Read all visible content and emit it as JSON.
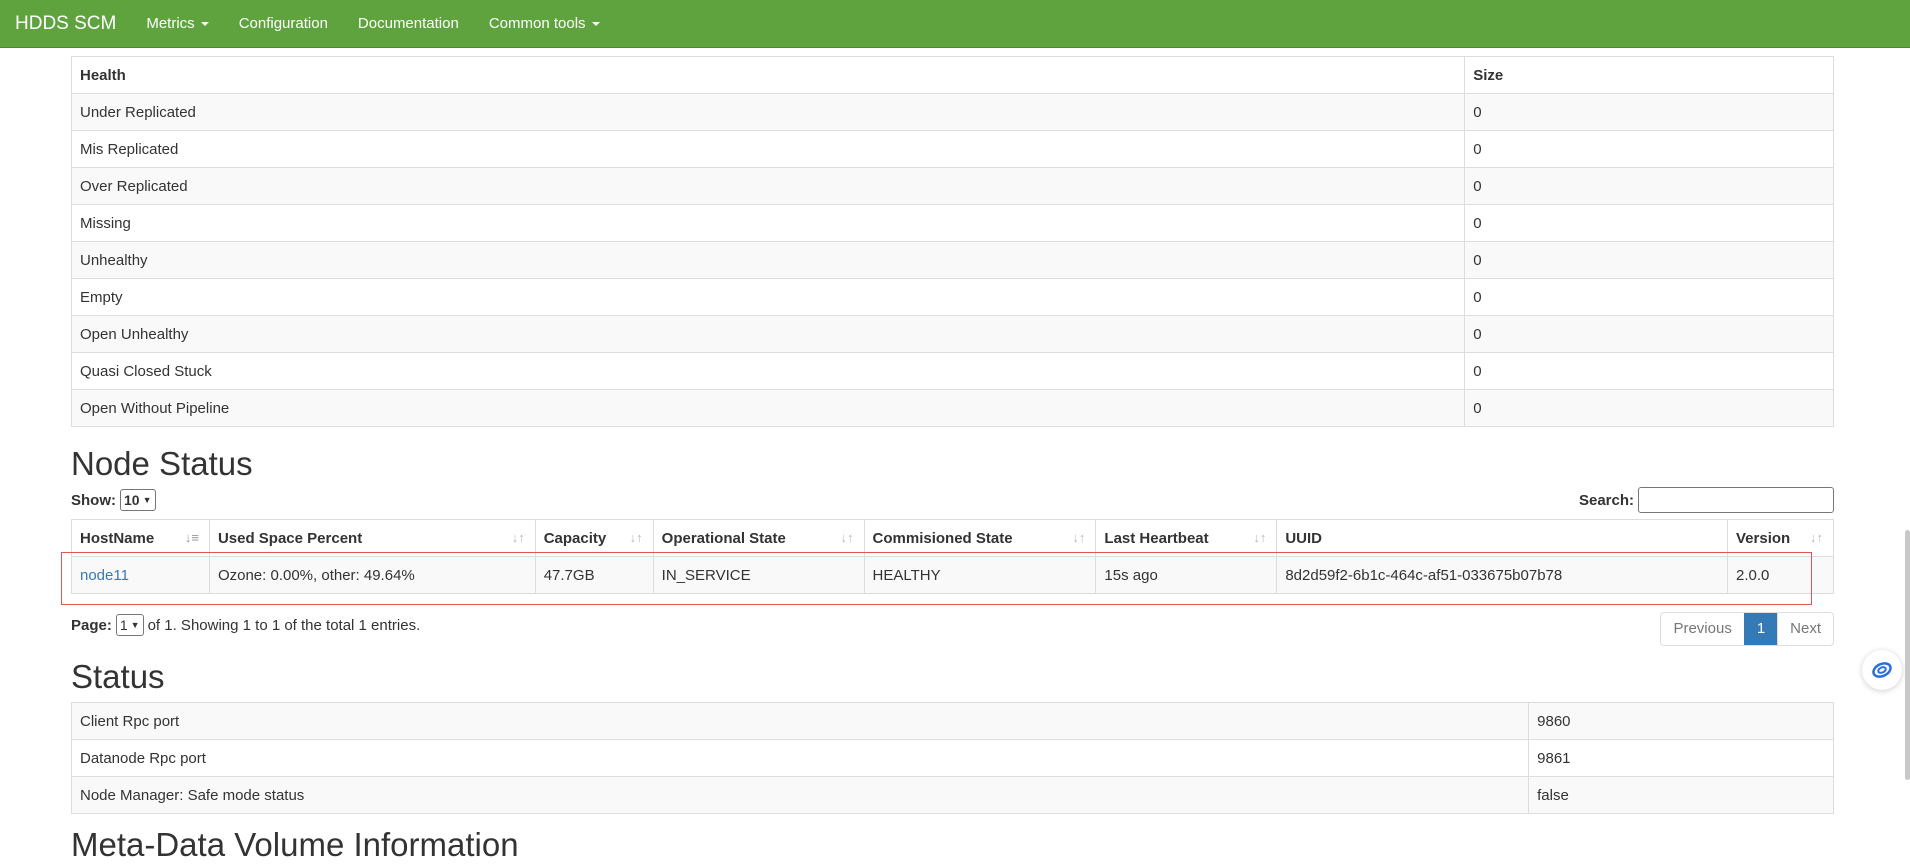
{
  "nav": {
    "brand": "HDDS SCM",
    "items": [
      {
        "label": "Metrics",
        "dropdown": true
      },
      {
        "label": "Configuration",
        "dropdown": false
      },
      {
        "label": "Documentation",
        "dropdown": false
      },
      {
        "label": "Common tools",
        "dropdown": true
      }
    ]
  },
  "health_table": {
    "headers": [
      "Health",
      "Size"
    ],
    "rows": [
      [
        "Under Replicated",
        "0"
      ],
      [
        "Mis Replicated",
        "0"
      ],
      [
        "Over Replicated",
        "0"
      ],
      [
        "Missing",
        "0"
      ],
      [
        "Unhealthy",
        "0"
      ],
      [
        "Empty",
        "0"
      ],
      [
        "Open Unhealthy",
        "0"
      ],
      [
        "Quasi Closed Stuck",
        "0"
      ],
      [
        "Open Without Pipeline",
        "0"
      ]
    ]
  },
  "node_status": {
    "title": "Node Status",
    "show_label": "Show:",
    "show_value": "10",
    "search_label": "Search:",
    "search_value": "",
    "headers": [
      "HostName",
      "Used Space Percent",
      "Capacity",
      "Operational State",
      "Commisioned State",
      "Last Heartbeat",
      "UUID",
      "Version"
    ],
    "rows": [
      {
        "host": "node11",
        "used": "Ozone: 0.00%, other: 49.64%",
        "capacity": "47.7GB",
        "op_state": "IN_SERVICE",
        "comm_state": "HEALTHY",
        "heartbeat": "15s ago",
        "uuid": "8d2d59f2-6b1c-464c-af51-033675b07b78",
        "version": "2.0.0"
      }
    ],
    "page_label": "Page:",
    "page_value": "1",
    "page_summary": "of 1. Showing 1 to 1 of the total 1 entries.",
    "pagination": {
      "prev": "Previous",
      "current": "1",
      "next": "Next"
    }
  },
  "status": {
    "title": "Status",
    "rows": [
      [
        "Client Rpc port",
        "9860"
      ],
      [
        "Datanode Rpc port",
        "9861"
      ],
      [
        "Node Manager: Safe mode status",
        "false"
      ]
    ]
  },
  "next_section_title": "Meta-Data Volume Information",
  "colors": {
    "navbar": "#5fa33e",
    "link": "#337ab7",
    "highlight_box": "#e05555"
  }
}
